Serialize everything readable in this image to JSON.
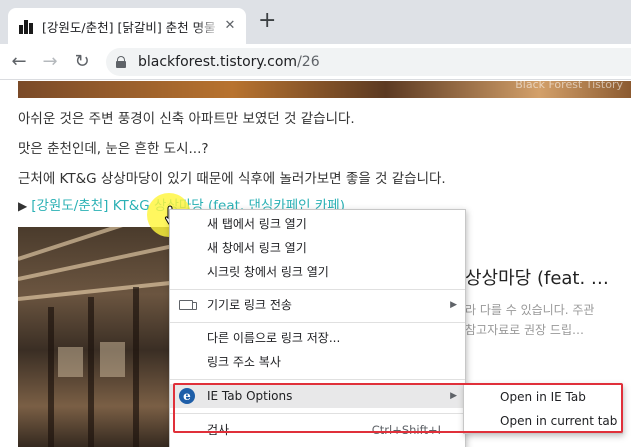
{
  "tab": {
    "title": "[강원도/춘천] [닭갈비] 춘천 명물",
    "close": "✕"
  },
  "newtab": "+",
  "nav": {
    "back": "←",
    "forward": "→",
    "reload": "↻"
  },
  "address": {
    "host": "blackforest.tistory.com",
    "path": "/26"
  },
  "page": {
    "banner_watermark": "Black Forest Tistory",
    "paragraphs": [
      "아쉬운 것은 주변 풍경이 신축 아파트만 보였던 것 같습니다.",
      "맛은 춘천인데, 눈은 흔한 도시...?",
      "근처에 KT&G 상상마당이 있기 때문에 식후에 놀러가보면 좋을 것 같습니다."
    ],
    "link_marker": "▶",
    "link_text": "[강원도/춘천] KT&G 상상마당 (feat. 댄싱카페인 카페)",
    "card_title": "상상마당 (feat. …",
    "card_desc": [
      "라 다를 수 있습니다. 주관",
      "참고자료로 권장 드립…"
    ]
  },
  "context_menu": {
    "items": [
      {
        "label": "새 탭에서 링크 열기"
      },
      {
        "label": "새 창에서 링크 열기"
      },
      {
        "label": "시크릿 창에서 링크 열기"
      },
      {
        "label": "기기로 링크 전송",
        "icon": "devices-icon",
        "submenu": true
      },
      {
        "label": "다른 이름으로 링크 저장..."
      },
      {
        "label": "링크 주소 복사"
      },
      {
        "label": "IE Tab Options",
        "icon": "ie-tab-icon",
        "submenu": true
      },
      {
        "label": "검사",
        "shortcut": "Ctrl+Shift+I"
      }
    ],
    "ie_icon_glyph": "e",
    "arrow_glyph": "▶"
  },
  "ie_submenu": {
    "items": [
      {
        "label": "Open in IE Tab"
      },
      {
        "label": "Open in current tab"
      }
    ]
  },
  "colors": {
    "link": "#2bb1b5",
    "highlight_box": "#e0303a",
    "cursor_halo": "#fff53c"
  }
}
